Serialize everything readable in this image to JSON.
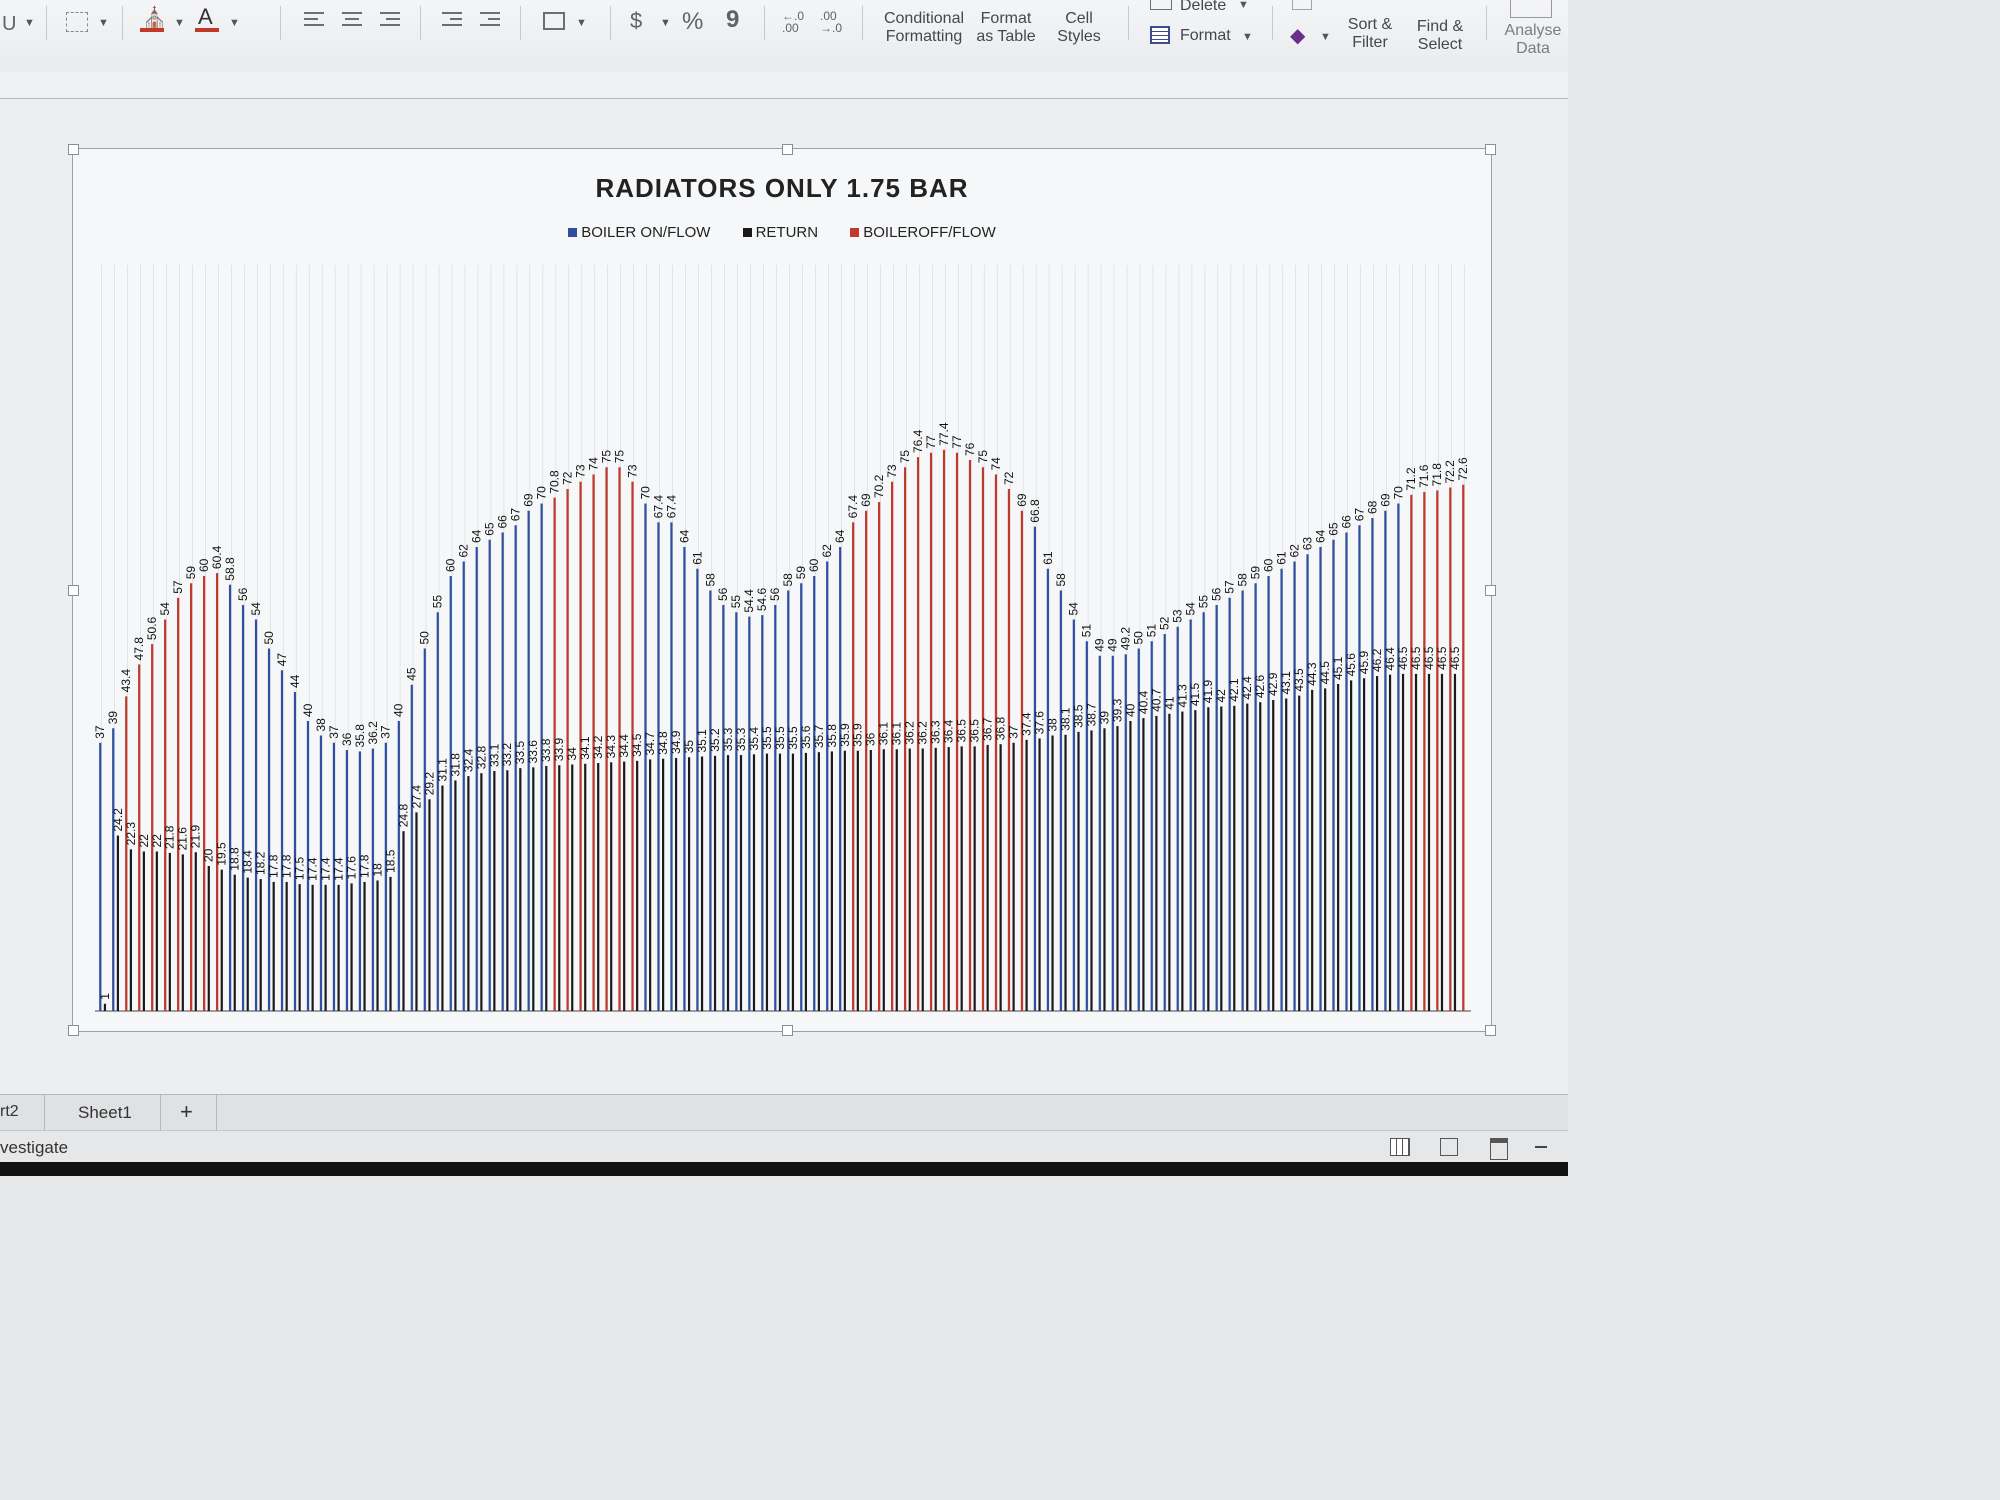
{
  "ribbon": {
    "icons": [
      "fill-color-icon",
      "font-color-icon",
      "align-left-icon",
      "align-center-icon",
      "align-right-icon",
      "decrease-indent-icon",
      "increase-indent-icon",
      "merge-icon",
      "currency-icon",
      "percent-icon",
      "comma-icon",
      "increase-decimal-icon",
      "decrease-decimal-icon",
      "fill-down-icon",
      "clear-icon"
    ],
    "percent": "%",
    "currency": "$",
    "comma": "9",
    "conditional_formatting": [
      "Conditional",
      "Formatting"
    ],
    "format_as_table": [
      "Format",
      "as Table"
    ],
    "cell_styles": [
      "Cell",
      "Styles"
    ],
    "delete": "Delete",
    "format": "Format",
    "sort_filter": [
      "Sort &",
      "Filter"
    ],
    "find_select": [
      "Find &",
      "Select"
    ],
    "analyse_data": [
      "Analyse",
      "Data"
    ],
    "font_color_letter": "A",
    "brand_red": "#c0392b"
  },
  "chart_data": {
    "type": "bar",
    "title": "RADIATORS ONLY 1.75 BAR",
    "xlabel": "",
    "ylabel": "",
    "ylim": [
      0,
      100
    ],
    "legend": {
      "position": "top",
      "entries": [
        "BOILER ON/FLOW",
        "RETURN",
        "BOILEROFF/FLOW"
      ]
    },
    "series": [
      {
        "name": "BOILER ON/FLOW",
        "color": "#2f4fa0"
      },
      {
        "name": "RETURN",
        "color": "#1a1a1a"
      },
      {
        "name": "BOILEROFF/FLOW",
        "color": "#c0392b"
      }
    ],
    "flow_values": [
      37,
      39,
      43.4,
      47.8,
      50.6,
      54,
      57,
      59,
      60,
      60.4,
      58.8,
      56,
      54,
      50,
      47,
      44,
      40,
      38,
      37,
      36,
      35.8,
      36.2,
      37,
      40,
      45,
      50,
      55,
      60,
      62,
      64,
      65,
      66,
      67,
      69,
      70,
      70.8,
      72,
      73,
      74,
      75,
      75,
      73,
      70,
      67.4,
      67.4,
      64,
      61,
      58,
      56,
      55,
      54.4,
      54.6,
      56,
      58,
      59,
      60,
      62,
      64,
      67.4,
      69,
      70.2,
      73,
      75,
      76.4,
      77,
      77.4,
      77,
      76,
      75,
      74,
      72,
      69,
      66.8,
      61,
      58,
      54,
      51,
      49,
      49,
      49.2,
      50,
      51,
      52,
      53,
      54,
      55,
      56,
      57,
      58,
      59,
      60,
      61,
      62,
      63,
      64,
      65,
      66,
      67,
      68,
      69,
      70,
      71.2,
      71.6,
      71.8,
      72.2,
      72.6
    ],
    "flow_states": [
      "on",
      "on",
      "off",
      "off",
      "off",
      "off",
      "off",
      "off",
      "off",
      "off",
      "on",
      "on",
      "on",
      "on",
      "on",
      "on",
      "on",
      "on",
      "on",
      "on",
      "on",
      "on",
      "on",
      "on",
      "on",
      "on",
      "on",
      "on",
      "on",
      "on",
      "on",
      "on",
      "on",
      "on",
      "on",
      "off",
      "off",
      "off",
      "off",
      "off",
      "off",
      "off",
      "on",
      "on",
      "on",
      "on",
      "on",
      "on",
      "on",
      "on",
      "on",
      "on",
      "on",
      "on",
      "on",
      "on",
      "on",
      "on",
      "off",
      "off",
      "off",
      "off",
      "off",
      "off",
      "off",
      "off",
      "off",
      "off",
      "off",
      "off",
      "off",
      "off",
      "on",
      "on",
      "on",
      "on",
      "on",
      "on",
      "on",
      "on",
      "on",
      "on",
      "on",
      "on",
      "on",
      "on",
      "on",
      "on",
      "on",
      "on",
      "on",
      "on",
      "on",
      "on",
      "on",
      "on",
      "on",
      "on",
      "on",
      "on",
      "on",
      "off",
      "off",
      "off",
      "off",
      "off"
    ],
    "return_values": [
      1,
      24.2,
      22.3,
      22,
      22,
      21.8,
      21.6,
      21.9,
      20,
      19.5,
      18.8,
      18.4,
      18.2,
      17.8,
      17.8,
      17.5,
      17.4,
      17.4,
      17.4,
      17.6,
      17.8,
      18,
      18.5,
      24.8,
      27.4,
      29.2,
      31.1,
      31.8,
      32.4,
      32.8,
      33.1,
      33.2,
      33.5,
      33.6,
      33.8,
      33.9,
      34,
      34.1,
      34.2,
      34.3,
      34.4,
      34.5,
      34.7,
      34.8,
      34.9,
      35,
      35.1,
      35.2,
      35.3,
      35.3,
      35.4,
      35.5,
      35.5,
      35.5,
      35.6,
      35.7,
      35.8,
      35.9,
      35.9,
      36,
      36.1,
      36.1,
      36.2,
      36.2,
      36.3,
      36.4,
      36.5,
      36.5,
      36.7,
      36.8,
      37,
      37.4,
      37.6,
      38,
      38.1,
      38.5,
      38.7,
      39,
      39.3,
      40,
      40.4,
      40.7,
      41,
      41.3,
      41.5,
      41.9,
      42,
      42.1,
      42.4,
      42.6,
      42.9,
      43.1,
      43.5,
      44.3,
      44.5,
      45.1,
      45.6,
      45.9,
      46.2,
      46.4,
      46.5,
      46.5,
      46.5,
      46.5,
      46.5
    ]
  },
  "sheet": {
    "tabs": [
      "rt2",
      "Sheet1"
    ],
    "add_tab": "+",
    "status": "vestigate"
  }
}
